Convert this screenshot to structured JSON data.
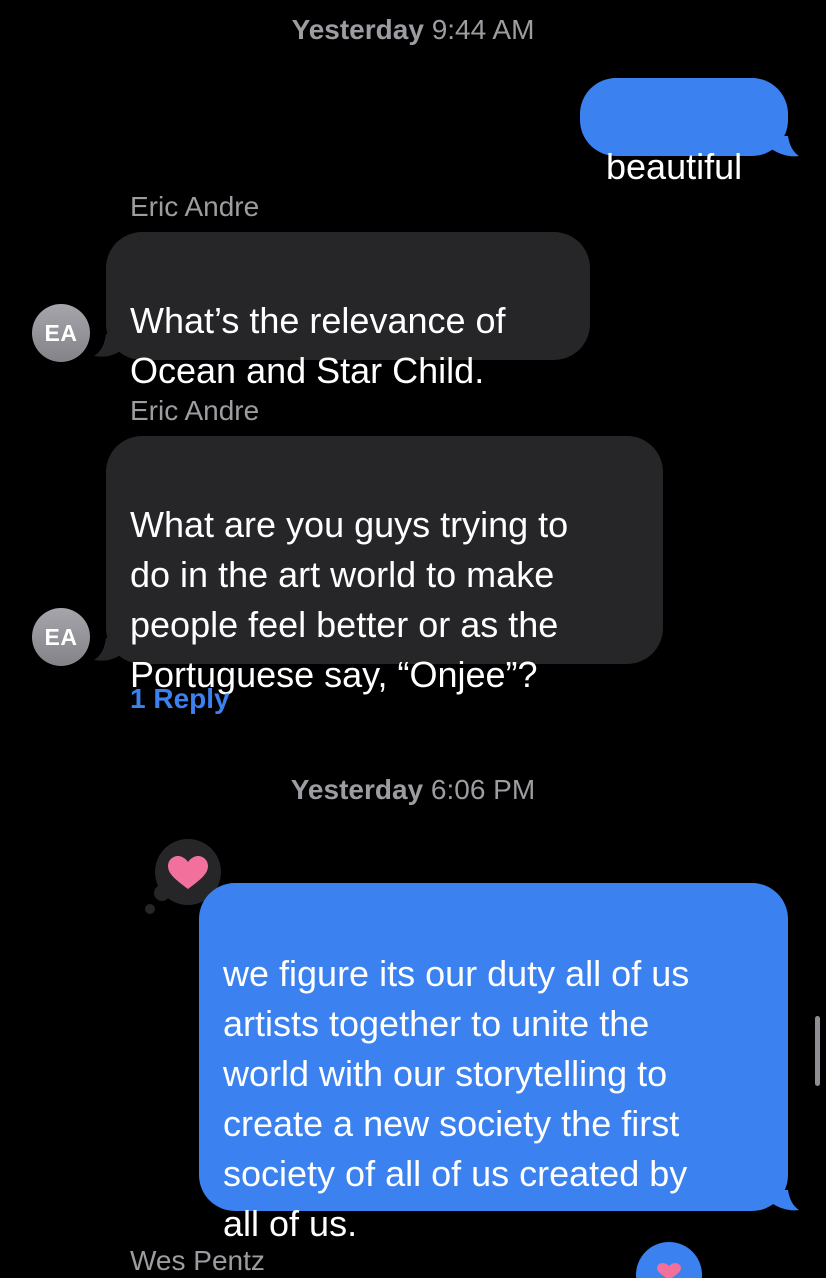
{
  "conversation": {
    "timestamp_1": {
      "day": "Yesterday",
      "time": "9:44 AM"
    },
    "timestamp_2": {
      "day": "Yesterday",
      "time": "6:06 PM"
    },
    "messages": [
      {
        "direction": "outgoing",
        "text": "beautiful"
      },
      {
        "direction": "incoming",
        "sender": "Eric Andre",
        "avatar_initials": "EA",
        "text": "What’s the relevance of\nOcean and Star Child."
      },
      {
        "direction": "incoming",
        "sender": "Eric Andre",
        "avatar_initials": "EA",
        "text": "What are you guys trying to\ndo in the art world to make\npeople feel better or as the\nPortuguese say, “Onjee”?",
        "reply_link": "1 Reply"
      },
      {
        "direction": "outgoing",
        "text": "we figure its our duty all of us\nartists together to unite the\nworld with our storytelling to\ncreate a new society the first\nsociety of all of us created by\nall of us.",
        "tapback": "heart-icon"
      },
      {
        "direction": "incoming",
        "sender": "Wes Pentz"
      }
    ]
  },
  "colors": {
    "background": "#000000",
    "incoming_bubble": "#262628",
    "outgoing_bubble": "#3b82f0",
    "heart": "#f2709c",
    "secondary_text": "#9c9ca1",
    "link": "#3b82f0"
  },
  "icons": {
    "tapback": "heart-icon",
    "partial_tapback": "heart-icon"
  }
}
